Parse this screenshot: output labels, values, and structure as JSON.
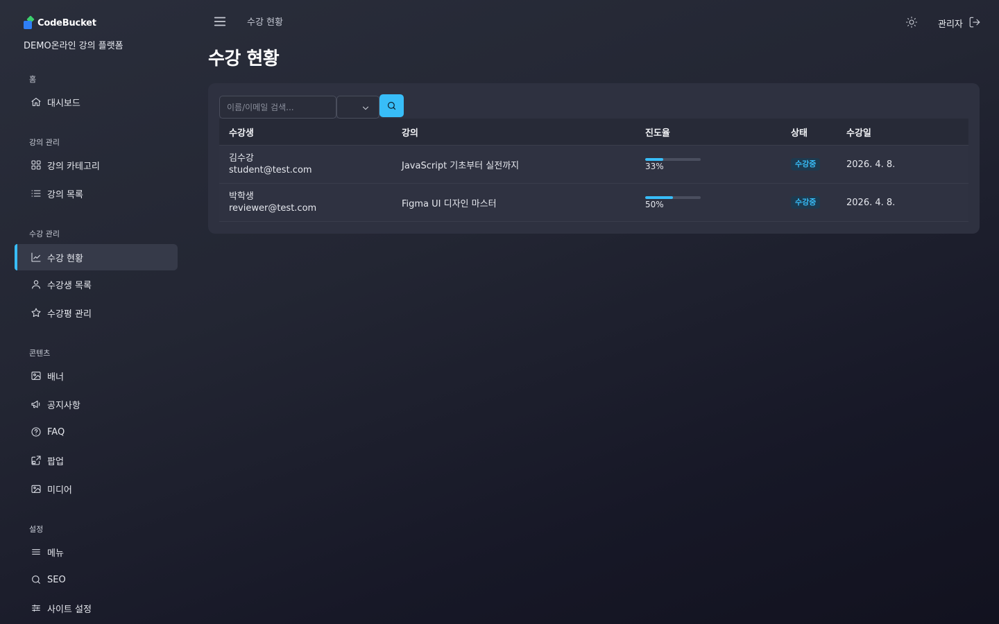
{
  "brand": {
    "name": "CodeBucket",
    "site_name": "DEMO온라인 강의 플랫폼"
  },
  "sidebar": {
    "sections": [
      {
        "label": "홈",
        "items": [
          {
            "label": "대시보드",
            "icon": "home-icon"
          }
        ]
      },
      {
        "label": "강의 관리",
        "items": [
          {
            "label": "강의 카테고리",
            "icon": "grid-icon"
          },
          {
            "label": "강의 목록",
            "icon": "list-icon"
          }
        ]
      },
      {
        "label": "수강 관리",
        "items": [
          {
            "label": "수강 현황",
            "icon": "chart-line-icon",
            "active": true
          },
          {
            "label": "수강생 목록",
            "icon": "user-icon"
          },
          {
            "label": "수강평 관리",
            "icon": "star-icon"
          }
        ]
      },
      {
        "label": "콘텐츠",
        "items": [
          {
            "label": "배너",
            "icon": "image-icon"
          },
          {
            "label": "공지사항",
            "icon": "megaphone-icon"
          },
          {
            "label": "FAQ",
            "icon": "help-circle-icon"
          },
          {
            "label": "팝업",
            "icon": "popup-icon"
          },
          {
            "label": "미디어",
            "icon": "images-icon"
          }
        ]
      },
      {
        "label": "설정",
        "items": [
          {
            "label": "메뉴",
            "icon": "menu-icon"
          },
          {
            "label": "SEO",
            "icon": "search-icon"
          },
          {
            "label": "사이트 설정",
            "icon": "sliders-icon"
          }
        ]
      }
    ]
  },
  "header": {
    "breadcrumb": "수강 현황",
    "user": "관리자"
  },
  "page": {
    "title": "수강 현황"
  },
  "filters": {
    "search_placeholder": "이름/이메일 검색...",
    "select_value": ""
  },
  "table": {
    "columns": [
      "수강생",
      "강의",
      "진도율",
      "상태",
      "수강일"
    ],
    "rows": [
      {
        "name": "김수강",
        "email": "student@test.com",
        "course": "JavaScript 기초부터 실전까지",
        "progress": 33,
        "progress_label": "33%",
        "status": "수강중",
        "date": "2026. 4. 8."
      },
      {
        "name": "박학생",
        "email": "reviewer@test.com",
        "course": "Figma UI 디자인 마스터",
        "progress": 50,
        "progress_label": "50%",
        "status": "수강중",
        "date": "2026. 4. 8."
      }
    ]
  },
  "colors": {
    "accent": "#38bdf8",
    "background": "#232633",
    "card": "#2e3140"
  }
}
